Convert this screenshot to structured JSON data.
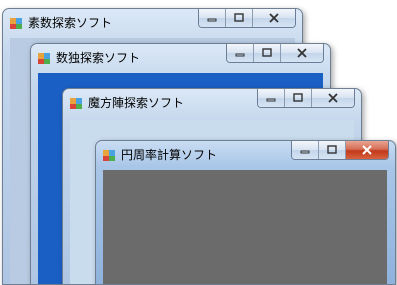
{
  "windows": [
    {
      "id": "sosuu",
      "title": "素数探索ソフト"
    },
    {
      "id": "suudoku",
      "title": "数独探索ソフト"
    },
    {
      "id": "mahoujin",
      "title": "魔方陣探索ソフト"
    },
    {
      "id": "enshuu",
      "title": "円周率計算ソフト"
    }
  ],
  "icons": {
    "app": "application-icon",
    "minimize": "minimize-icon",
    "maximize": "maximize-icon",
    "close": "close-icon"
  },
  "colors": {
    "window_frame": "#aec6e3",
    "client_gray": "#6b6b6b",
    "client_blue": "#1a5fc4",
    "close_active": "#c0391b"
  }
}
